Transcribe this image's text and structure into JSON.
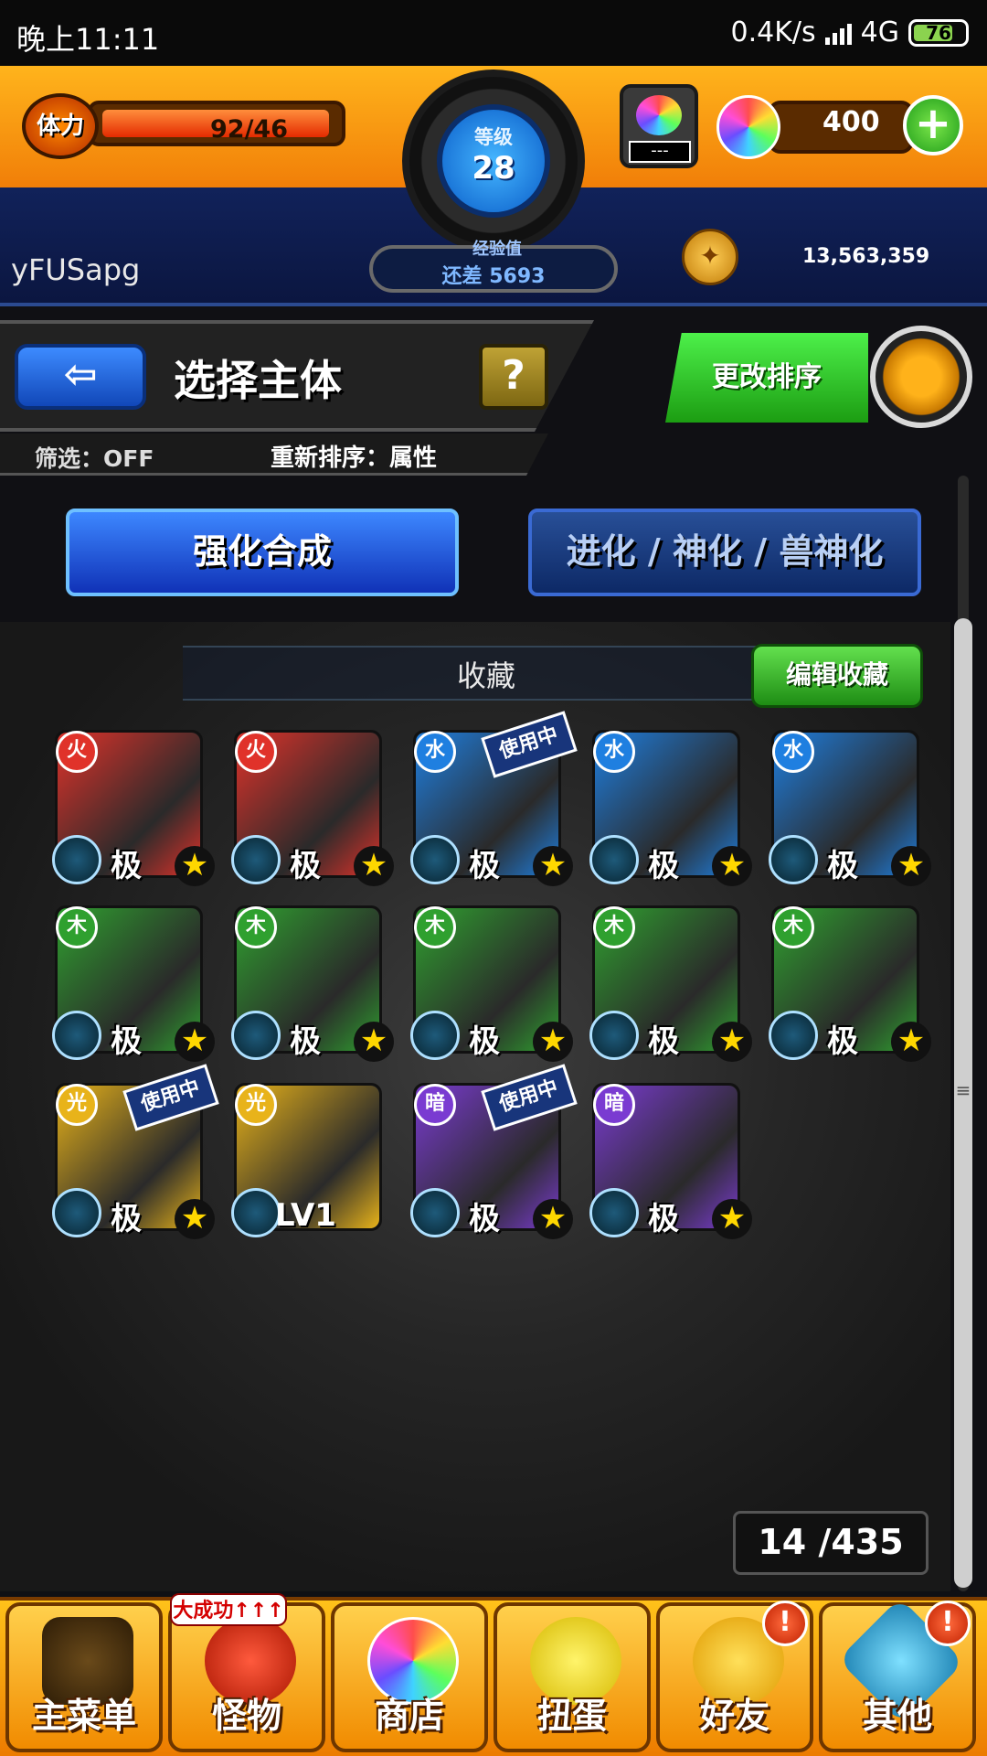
{
  "status_bar": {
    "time": "晚上11:11",
    "speed": "0.4K/s",
    "network": "4G",
    "battery": "76"
  },
  "top": {
    "stamina_label": "体力",
    "stamina_value": "92/46",
    "level_label": "等级",
    "level": "28",
    "exp_label": "经验值",
    "exp_remaining": "还差 5693",
    "gem_box_label": "---",
    "orbs": "400",
    "username": "yFUSapg",
    "gold": "13,563,359"
  },
  "header": {
    "title": "选择主体",
    "help_label": "?",
    "filter": "筛选：OFF",
    "resort": "重新排序：属性",
    "sort_button": "更改排序"
  },
  "tabs": [
    {
      "label": "强化合成",
      "active": true
    },
    {
      "label": "进化 / 神化 / 兽神化",
      "active": false
    }
  ],
  "favorites": {
    "title": "收藏",
    "edit_button": "编辑收藏"
  },
  "cards": [
    {
      "element": "fire",
      "badge": "极",
      "in_use": false,
      "lv": ""
    },
    {
      "element": "fire",
      "badge": "极",
      "in_use": false,
      "lv": ""
    },
    {
      "element": "water",
      "badge": "极",
      "in_use": true,
      "lv": ""
    },
    {
      "element": "water",
      "badge": "极",
      "in_use": false,
      "lv": ""
    },
    {
      "element": "water",
      "badge": "极",
      "in_use": false,
      "lv": ""
    },
    {
      "element": "wood",
      "badge": "极",
      "in_use": false,
      "lv": ""
    },
    {
      "element": "wood",
      "badge": "极",
      "in_use": false,
      "lv": ""
    },
    {
      "element": "wood",
      "badge": "极",
      "in_use": false,
      "lv": ""
    },
    {
      "element": "wood",
      "badge": "极",
      "in_use": false,
      "lv": ""
    },
    {
      "element": "wood",
      "badge": "极",
      "in_use": false,
      "lv": ""
    },
    {
      "element": "light",
      "badge": "极",
      "in_use": true,
      "lv": ""
    },
    {
      "element": "light",
      "badge": "",
      "in_use": false,
      "lv": "LV1"
    },
    {
      "element": "dark",
      "badge": "极",
      "in_use": true,
      "lv": ""
    },
    {
      "element": "dark",
      "badge": "极",
      "in_use": false,
      "lv": ""
    }
  ],
  "in_use_label": "使用中",
  "counter": "14 /435",
  "nav": [
    {
      "label": "主菜单",
      "icon": "castle-gate-icon",
      "alert": false
    },
    {
      "label": "怪物",
      "icon": "monster-icon",
      "alert": false
    },
    {
      "label": "商店",
      "icon": "rainbow-orb-icon",
      "alert": false
    },
    {
      "label": "扭蛋",
      "icon": "egg-icon",
      "alert": false
    },
    {
      "label": "好友",
      "icon": "friends-icon",
      "alert": true
    },
    {
      "label": "其他",
      "icon": "other-icon",
      "alert": true
    }
  ],
  "promo_tag": "大成功↑↑↑",
  "colors": {
    "fire": "#e0322a",
    "water": "#1f7fe0",
    "wood": "#2fa02f",
    "light": "#e8b31a",
    "dark": "#7a3bd1"
  }
}
